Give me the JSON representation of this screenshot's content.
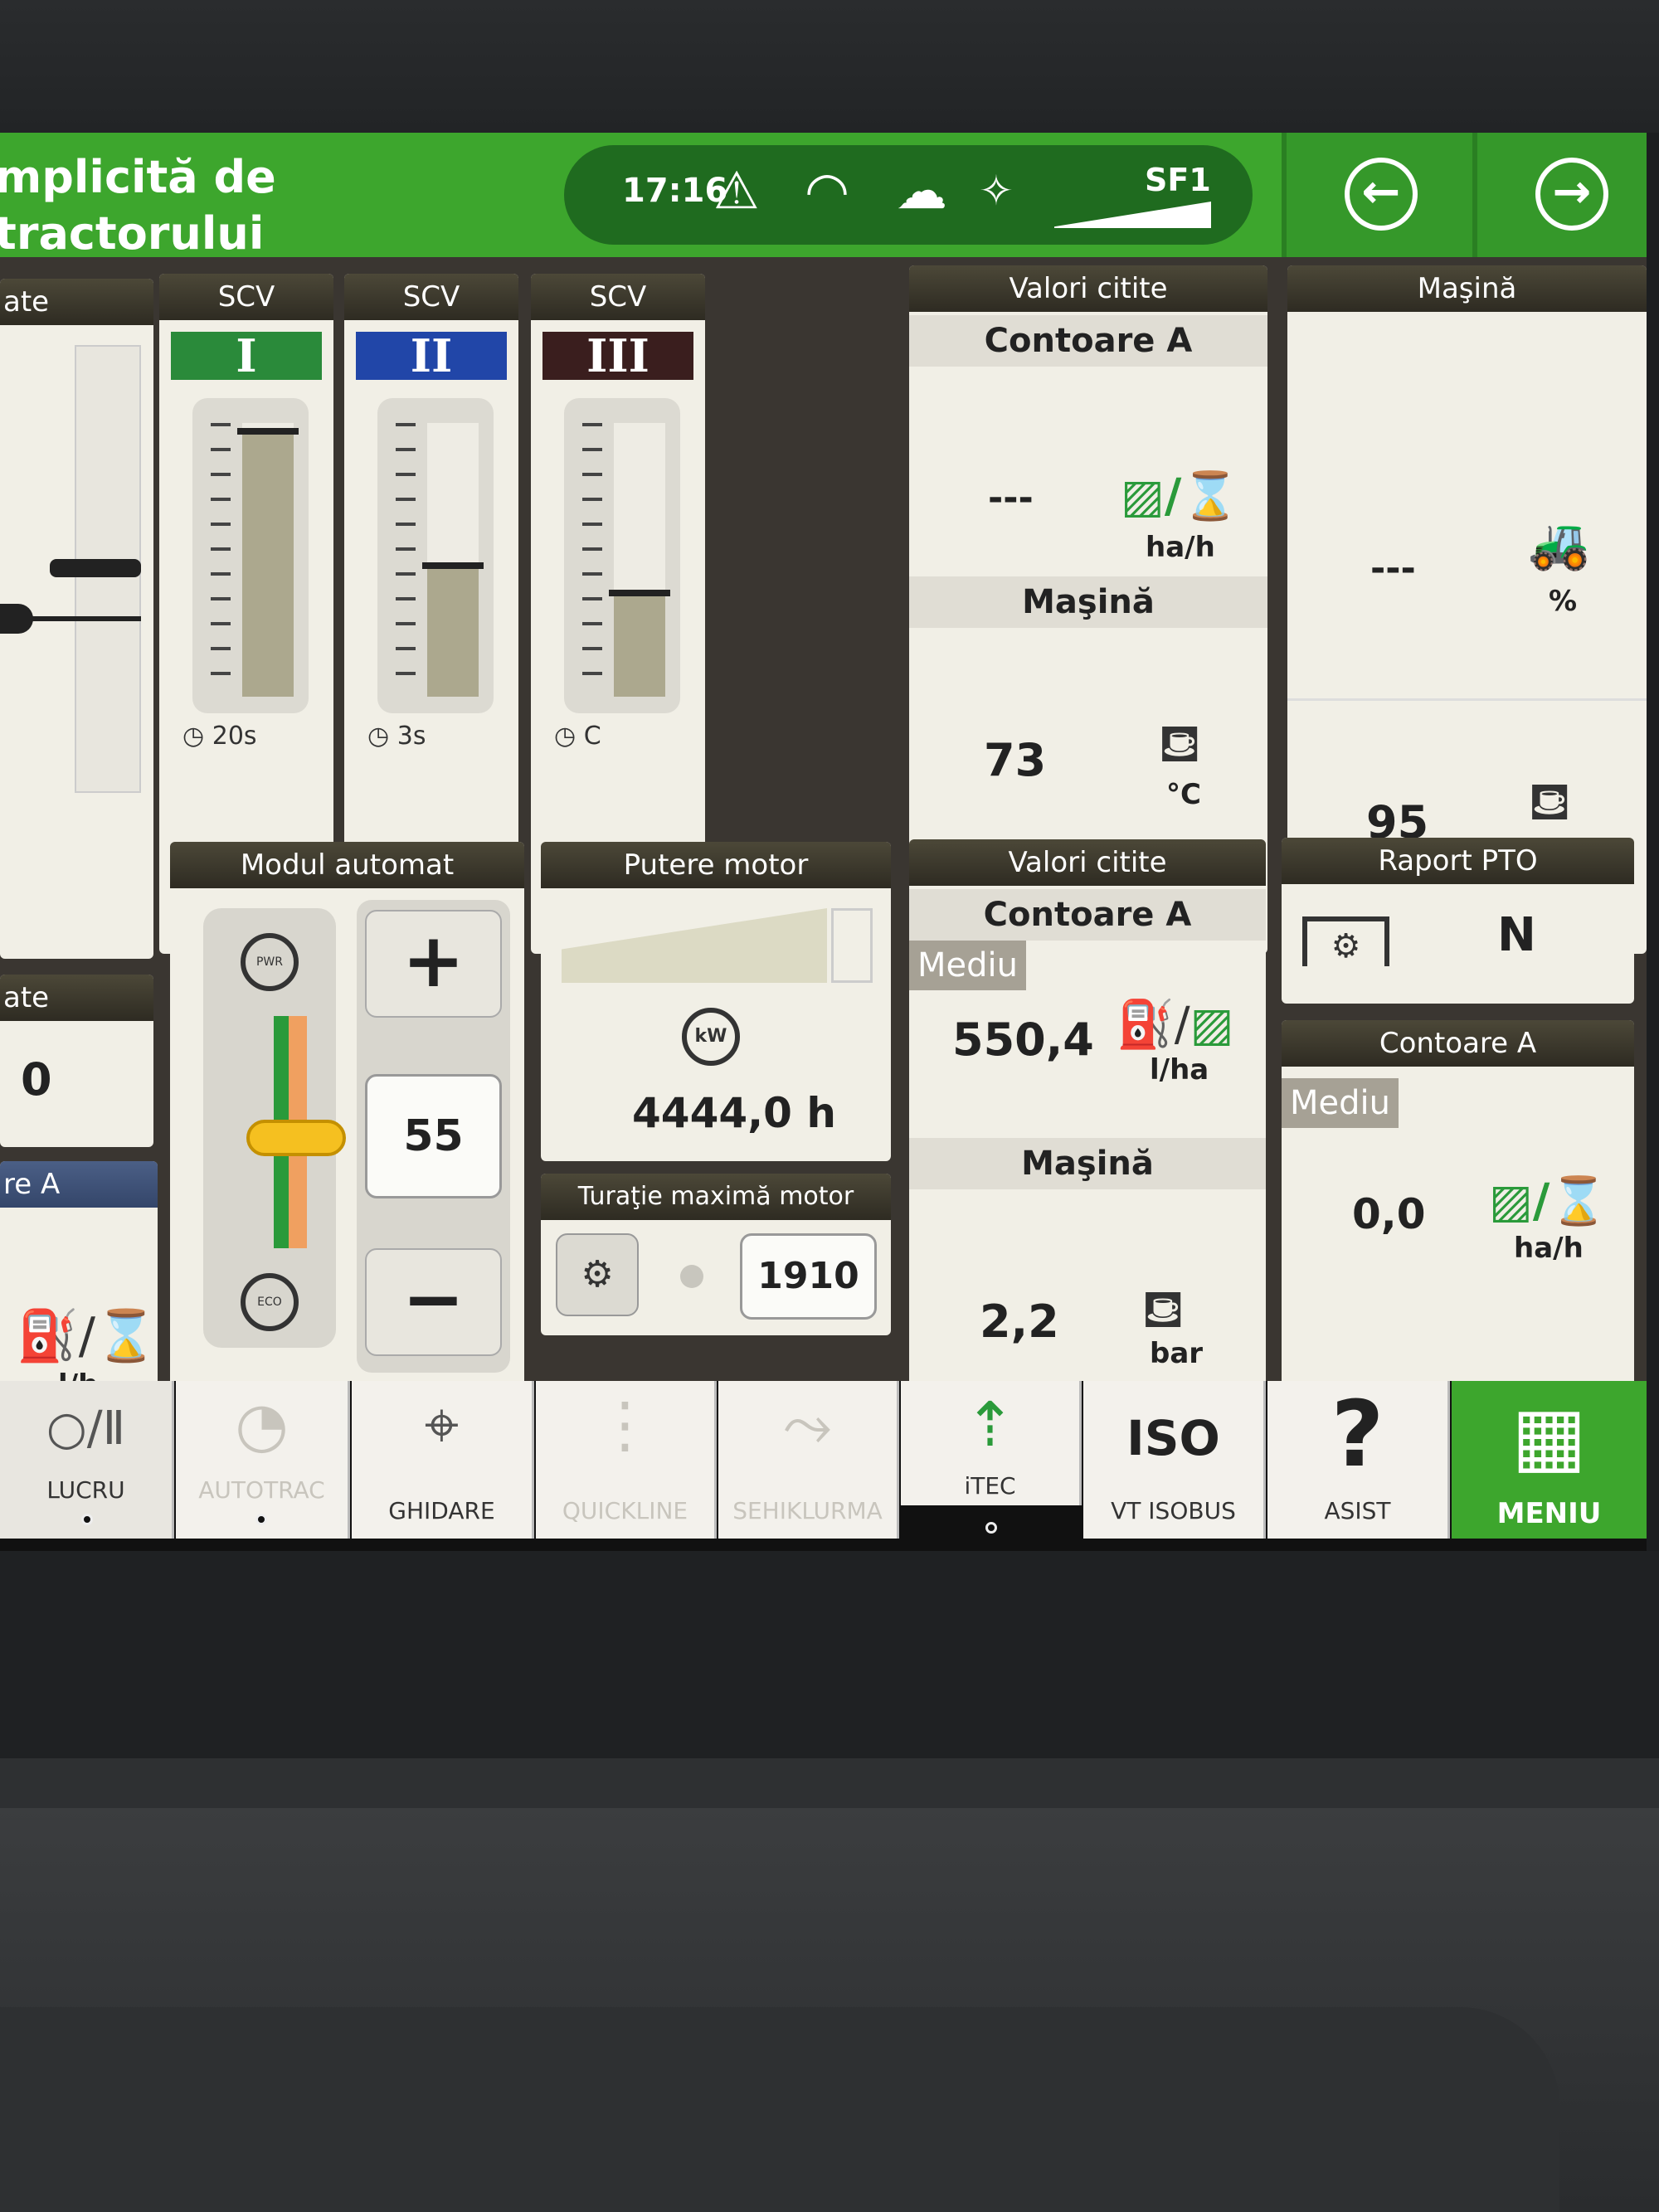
{
  "header": {
    "title": "mplicită de\ntractorului",
    "clock": "17:16",
    "sf": "SF1",
    "back_icon": "←",
    "forward_icon": "→"
  },
  "left_panel": {
    "header1": "ate",
    "header2": "ate",
    "value": "0",
    "header3": "re A",
    "unit": "l/h"
  },
  "scv": [
    {
      "header": "SCV",
      "roman": "I",
      "color": "#2a8a3a",
      "level": 0.97,
      "timer": "20s"
    },
    {
      "header": "SCV",
      "roman": "II",
      "color": "#2146a8",
      "level": 0.48,
      "timer": "3s"
    },
    {
      "header": "SCV",
      "roman": "III",
      "color": "#3a1e1e",
      "level": 0.38,
      "timer": "C"
    }
  ],
  "valori1": {
    "header": "Valori citite",
    "sub1": "Contoare A",
    "val1": "---",
    "unit1": "ha/h",
    "sub2": "Maşină",
    "val2": "73",
    "unit2": "°C"
  },
  "masina": {
    "header": "Maşină",
    "val1": "---",
    "unit1": "%",
    "val2": "95",
    "unit2": "°C"
  },
  "modul": {
    "header": "Modul automat",
    "plus": "+",
    "value": "55",
    "minus": "−",
    "pwr": "PWR",
    "eco": "ECO",
    "level": 0.45
  },
  "putere": {
    "header": "Putere motor",
    "hours": "4444,0 h",
    "kw": "kW"
  },
  "turatie": {
    "header": "Turaţie maximă motor",
    "value": "1910"
  },
  "valori2": {
    "header": "Valori citite",
    "sub1": "Contoare A",
    "mediu": "Mediu",
    "val1": "550,4",
    "unit1": "l/ha",
    "sub2": "Maşină",
    "val2": "2,2",
    "unit2": "bar"
  },
  "pto": {
    "header": "Raport PTO",
    "value": "N"
  },
  "contoare": {
    "header": "Contoare A",
    "mediu": "Mediu",
    "value": "0,0",
    "unit": "ha/h"
  },
  "tabs": [
    {
      "label": "LUCRU",
      "icon": "○/Ⅱ"
    },
    {
      "label": "AUTOTRAC",
      "icon": "◔"
    },
    {
      "label": "GHIDARE",
      "icon": "⌖"
    },
    {
      "label": "QUICKLINE",
      "icon": "⋮"
    },
    {
      "label": "SEHIKLURMA",
      "icon": "⤳"
    },
    {
      "label": "iTEC",
      "icon": "⇡"
    },
    {
      "label": "VT ISOBUS",
      "icon": "ISO"
    },
    {
      "label": "ASIST",
      "icon": "?"
    },
    {
      "label": "MENIU",
      "icon": "▦"
    }
  ]
}
